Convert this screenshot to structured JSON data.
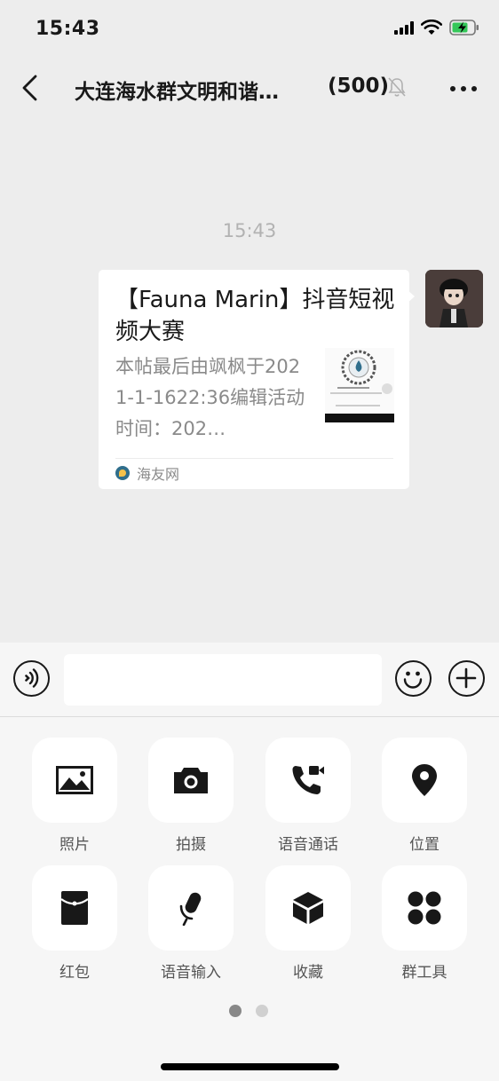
{
  "status": {
    "time": "15:43"
  },
  "nav": {
    "title": "大连海水群文明和谐…",
    "member_count": "(500)"
  },
  "chat": {
    "timestamp": "15:43",
    "card": {
      "title": "【Fauna Marin】抖音短视频大赛",
      "description": "本帖最后由飒枫于2021-1-1622:36编辑活动时间：202…",
      "source": "海友网"
    }
  },
  "input": {
    "placeholder": ""
  },
  "tools": [
    {
      "label": "照片",
      "icon": "photo-icon"
    },
    {
      "label": "拍摄",
      "icon": "camera-icon"
    },
    {
      "label": "语音通话",
      "icon": "video-call-icon"
    },
    {
      "label": "位置",
      "icon": "location-icon"
    },
    {
      "label": "红包",
      "icon": "red-packet-icon"
    },
    {
      "label": "语音输入",
      "icon": "microphone-icon"
    },
    {
      "label": "收藏",
      "icon": "favorites-icon"
    },
    {
      "label": "群工具",
      "icon": "group-tools-icon"
    }
  ],
  "pagination": {
    "pages": 2,
    "current": 1
  },
  "colors": {
    "background": "#ededed",
    "panel": "#f6f6f6",
    "icon": "#181818",
    "dot_active": "#888888",
    "dot_inactive": "#d0d0d0",
    "battery": "#34c759"
  }
}
